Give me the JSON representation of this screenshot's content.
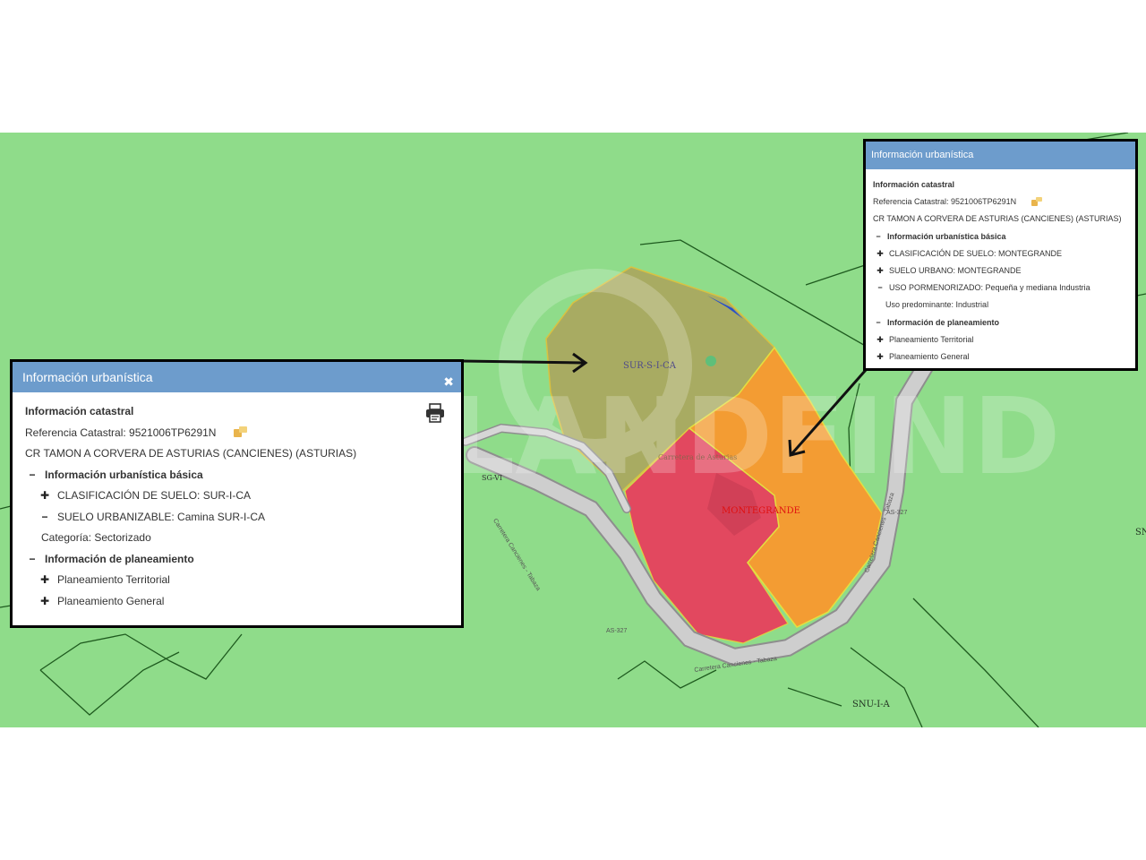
{
  "left_panel": {
    "title": "Información urbanística",
    "close_icon": "close-icon",
    "print_icon": "printer-icon",
    "photo_icon": "photo-icon",
    "section_catastral": "Información catastral",
    "referencia": "Referencia Catastral: 9521006TP6291N",
    "address": "CR TAMON A CORVERA DE ASTURIAS (CANCIENES) (ASTURIAS)",
    "basic_info": "Información urbanística básica",
    "clasificacion": "CLASIFICACIÓN DE SUELO: SUR-I-CA",
    "suelo": "SUELO URBANIZABLE: Camina SUR-I-CA",
    "categoria": "Categoría: Sectorizado",
    "planeamiento": "Información de planeamiento",
    "territorial": "Planeamiento Territorial",
    "general": "Planeamiento General"
  },
  "right_panel": {
    "title": "Información urbanística",
    "photo_icon": "photo-icon",
    "section_catastral": "Información catastral",
    "referencia": "Referencia Catastral: 9521006TP6291N",
    "address": "CR TAMON A CORVERA DE ASTURIAS (CANCIENES) (ASTURIAS)",
    "basic_info": "Información urbanística básica",
    "clasificacion": "CLASIFICACIÓN DE SUELO: MONTEGRANDE",
    "suelo": "SUELO URBANO: MONTEGRANDE",
    "uso": "USO PORMENORIZADO: Pequeña y mediana Industria",
    "uso_predominante": "Uso predominante: Industrial",
    "planeamiento": "Información de planeamiento",
    "territorial": "Planeamiento Territorial",
    "general": "Planeamiento General"
  },
  "map": {
    "labels": {
      "sur": "SUR-S-I-CA",
      "montegrande": "MONTEGRANDE",
      "snu": "SNU-I-A",
      "sn_edge": "SN",
      "sg": "SG-VI",
      "as327_a": "AS-327",
      "as327_b": "AS-327",
      "road_a": "Carretera Cancienes - Tabaza",
      "road_b": "Carretera Cancienes - Tabaza",
      "road_c": "Carretera Cancienes - Tabaza",
      "faint": "Carretera de Asturias"
    },
    "watermark": "LANDFIND",
    "colors": {
      "background": "#8fdc8a",
      "olive_zone": "#a8ab62",
      "orange_zone": "#f39c33",
      "red_zone": "#e2485f",
      "road": "#c9c9c9",
      "panel_header": "#6d9ccc"
    }
  }
}
